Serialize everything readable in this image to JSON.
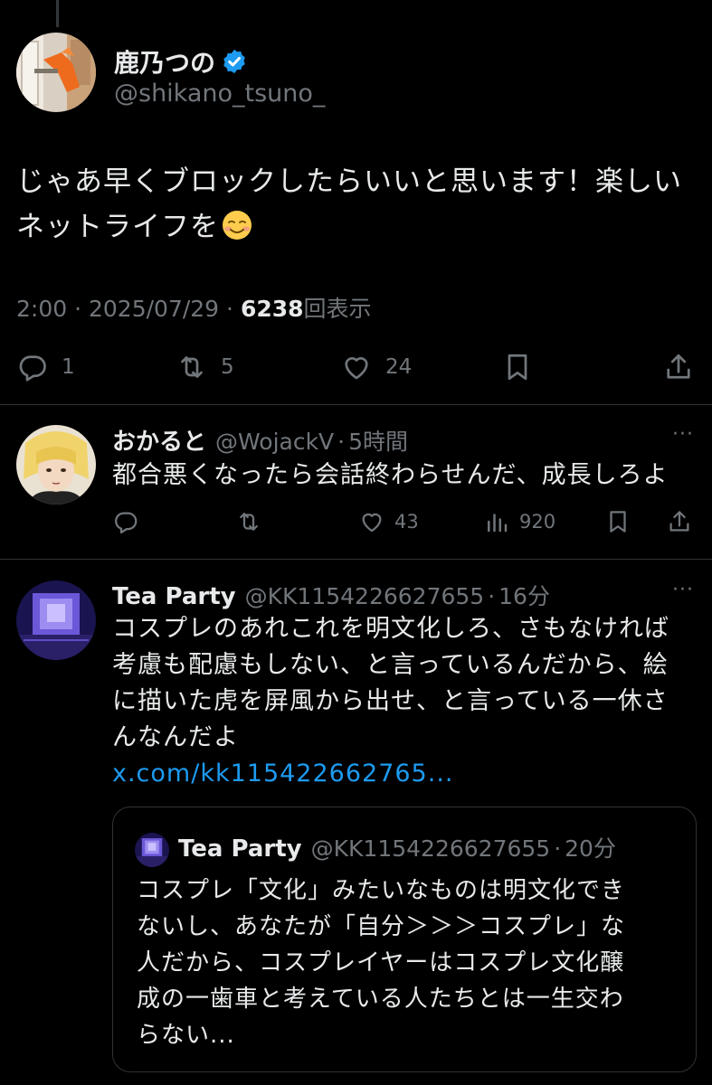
{
  "main_tweet": {
    "author_name": "鹿乃つの",
    "author_handle": "@shikano_tsuno_",
    "text_lines": [
      "じゃあ早くブロックしたらいいと思います！楽しい",
      "ネットライフを"
    ],
    "time": "2:00",
    "date": "2025/07/29",
    "views_count": "6238",
    "views_label": "回表示",
    "separator": "·",
    "replies": "1",
    "retweets": "5",
    "likes": "24"
  },
  "replies": [
    {
      "name": "おかると",
      "handle": "@WojackV",
      "time": "5時間",
      "more": "···",
      "text_lines": [
        "都合悪くなったら会話終わらせんだ、成長しろよ"
      ],
      "replies": "",
      "retweets": "",
      "likes": "43",
      "views": "920"
    },
    {
      "name": "Tea Party",
      "handle": "@KK1154226627655",
      "time": "16分",
      "more": "···",
      "text_lines": [
        "コスプレのあれこれを明文化しろ、さもなければ",
        "考慮も配慮もしない、と言っているんだから、絵",
        "に描いた虎を屏風から出せ、と言っている一休さ",
        "んなんだよ"
      ],
      "link": "x.com/kk115422662765...",
      "quote": {
        "name": "Tea Party",
        "handle": "@KK1154226627655",
        "time": "20分",
        "text_lines": [
          "コスプレ「文化」みたいなものは明文化でき",
          "ないし、あなたが「自分＞＞＞コスプレ」な",
          "人だから、コスプレイヤーはコスプレ文化醸",
          "成の一歯車と考えている人たちとは一生交わ",
          "らない..."
        ]
      }
    }
  ],
  "colors": {
    "background": "#000000",
    "text": "#e7e9ea",
    "muted": "#71767b",
    "link": "#1d9bf0",
    "verified": "#1d9bf0",
    "divider": "#2f3336"
  },
  "icons": [
    "reply-icon",
    "retweet-icon",
    "like-icon",
    "views-icon",
    "bookmark-icon",
    "share-icon",
    "verified-badge-icon",
    "smiling-face-emoji"
  ]
}
